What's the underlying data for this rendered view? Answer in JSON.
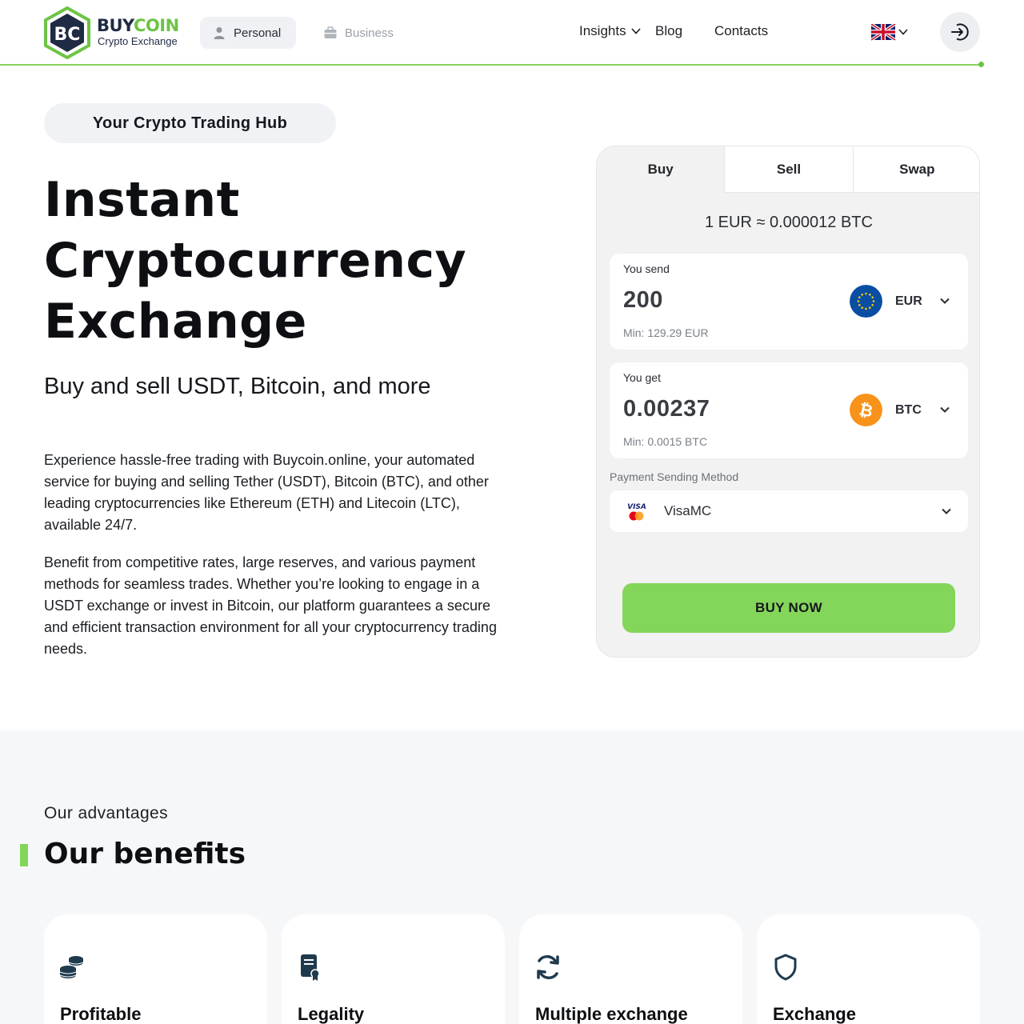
{
  "header": {
    "logo_word_buy": "BUY",
    "logo_word_coin": "COIN",
    "logo_sub": "Crypto Exchange",
    "segments": {
      "personal": "Personal",
      "business": "Business"
    },
    "nav": {
      "insights": "Insights",
      "blog": "Blog",
      "contacts": "Contacts"
    },
    "language_icon": "uk-flag-icon",
    "login_icon": "login-icon"
  },
  "hero": {
    "pill": "Your Crypto Trading Hub",
    "title_line1": "Instant",
    "title_line2": "Cryptocurrency",
    "title_line3": "Exchange",
    "subtitle": "Buy and sell USDT, Bitcoin, and more",
    "paragraph1": "Experience hassle-free trading with Buycoin.online, your automated service for buying and selling Tether (USDT), Bitcoin (BTC), and other leading cryptocurrencies like Ethereum (ETH) and Litecoin (LTC), available 24/7.",
    "paragraph2": "Benefit from competitive rates, large reserves, and various payment methods for seamless trades. Whether you’re looking to engage in a USDT exchange or invest in Bitcoin, our platform guarantees a secure and efficient transaction environment for all your cryptocurrency trading needs."
  },
  "exchange": {
    "tabs": [
      "Buy",
      "Sell",
      "Swap"
    ],
    "active_tab": "Buy",
    "rate": "1 EUR ≈ 0.000012 BTC",
    "send": {
      "label": "You send",
      "amount": "200",
      "currency": "EUR",
      "min": "Min: 129.29 EUR",
      "icon": "eu-flag-icon"
    },
    "get": {
      "label": "You get",
      "amount": "0.00237",
      "currency": "BTC",
      "min": "Min: 0.0015 BTC",
      "icon": "bitcoin-icon"
    },
    "payment_label": "Payment Sending Method",
    "payment_method": "VisaMC",
    "buy_button": "BUY NOW"
  },
  "benefits": {
    "eyebrow": "Our advantages",
    "title": "Our benefits",
    "cards": [
      {
        "title": "Profitable",
        "icon": "coins-stack-icon"
      },
      {
        "title": "Legality",
        "icon": "certificate-icon"
      },
      {
        "title": "Multiple exchange",
        "icon": "refresh-icon"
      },
      {
        "title": "Exchange",
        "icon": "shield-icon"
      }
    ]
  },
  "colors": {
    "accent_green": "#84d65a",
    "logo_navy": "#1f2a44",
    "btc_orange": "#f7931a",
    "eur_blue": "#0a4ea3"
  }
}
